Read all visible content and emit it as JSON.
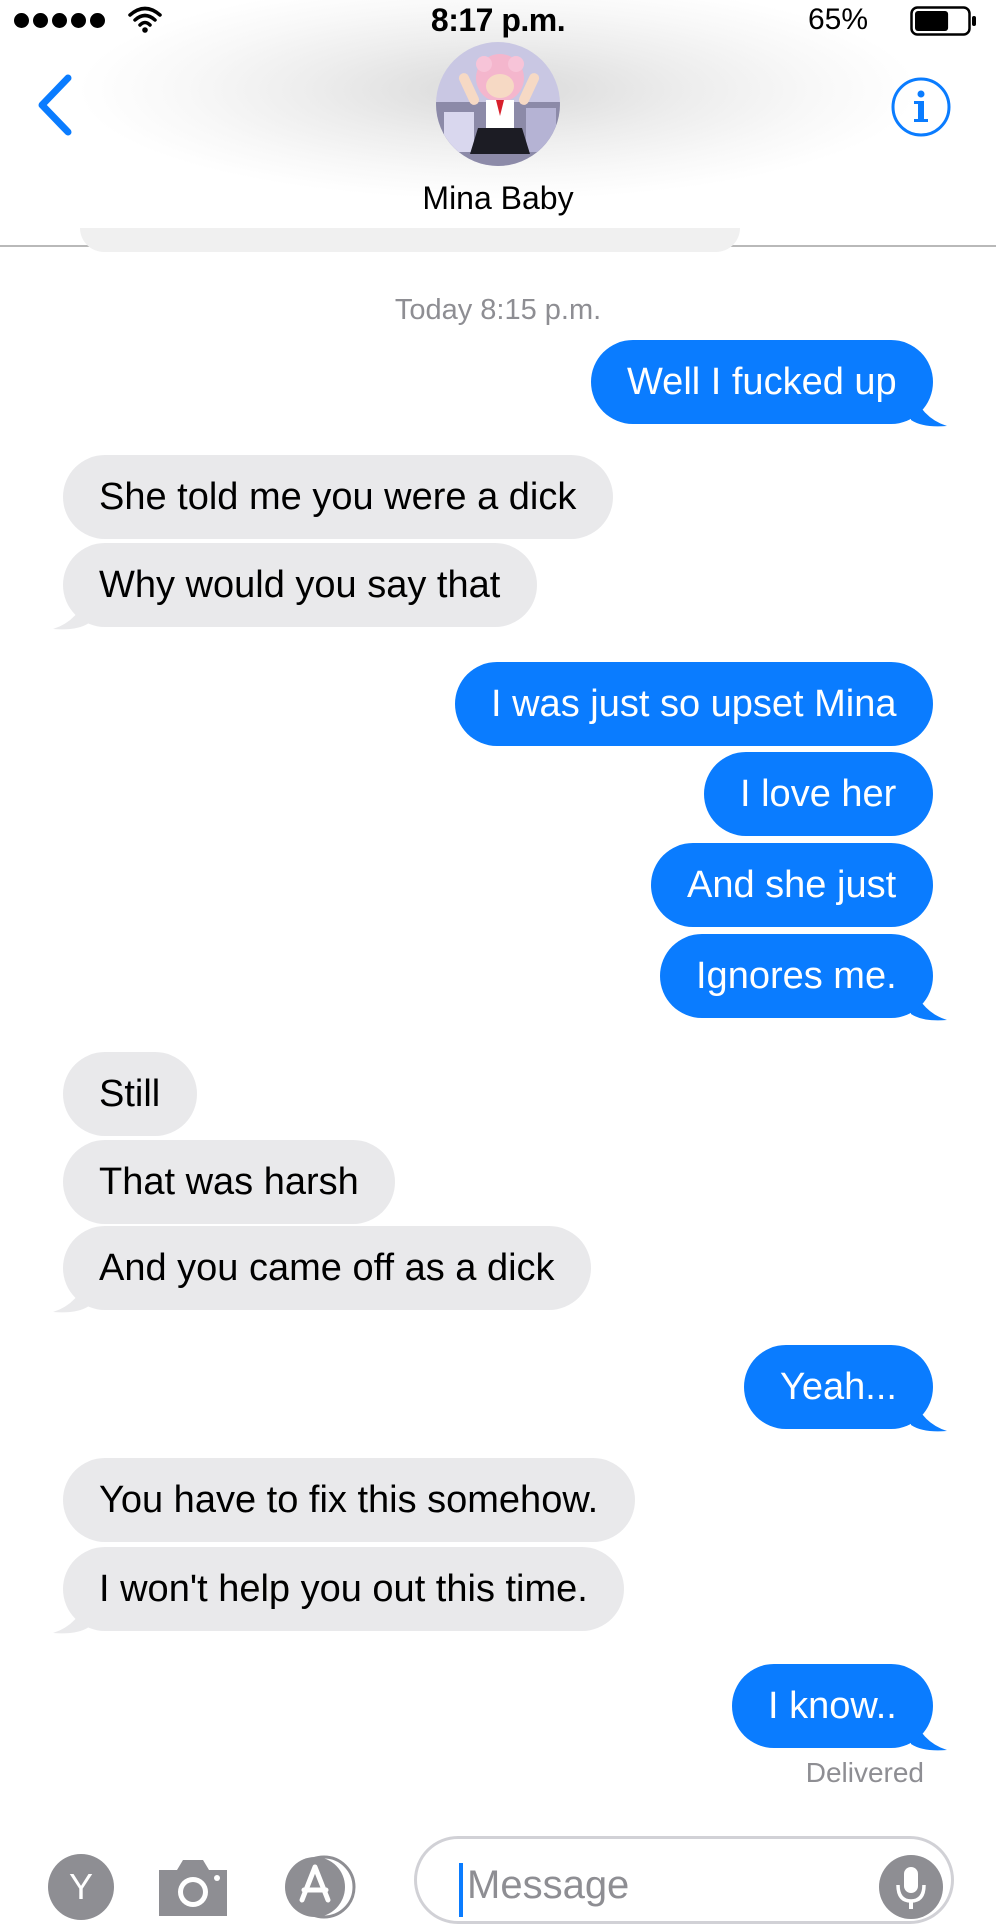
{
  "status_bar": {
    "time": "8:17 p.m.",
    "battery_percent": "65%",
    "battery_level": 0.65,
    "signal_bars": 5
  },
  "header": {
    "contact_name": "Mina Baby",
    "back_icon": "chevron-left-icon",
    "info_icon": "info-icon"
  },
  "conversation": {
    "timestamp": "Today 8:15 p.m.",
    "messages": [
      {
        "direction": "sent",
        "text": "Well I fucked up"
      },
      {
        "direction": "received",
        "text": "She told me you were a dick"
      },
      {
        "direction": "received",
        "text": "Why would you say that"
      },
      {
        "direction": "sent",
        "text": "I was just so upset Mina"
      },
      {
        "direction": "sent",
        "text": "I love her"
      },
      {
        "direction": "sent",
        "text": "And she just"
      },
      {
        "direction": "sent",
        "text": "Ignores me."
      },
      {
        "direction": "received",
        "text": "Still"
      },
      {
        "direction": "received",
        "text": "That was harsh"
      },
      {
        "direction": "received",
        "text": "And you came off as a dick"
      },
      {
        "direction": "sent",
        "text": "Yeah..."
      },
      {
        "direction": "received",
        "text": "You have to fix this somehow."
      },
      {
        "direction": "received",
        "text": "I won't help you out this time."
      },
      {
        "direction": "sent",
        "text": "I know.."
      }
    ],
    "delivery_status": "Delivered"
  },
  "composer": {
    "placeholder": "Message",
    "app_icon_label": "Y",
    "camera_icon": "camera-icon",
    "appstore_icon": "app-store-icon",
    "mic_icon": "microphone-icon"
  },
  "colors": {
    "sent_bubble": "#0a7cff",
    "received_bubble": "#e9e9eb",
    "accent": "#0a7cff",
    "secondary_text": "#8e8e93"
  }
}
